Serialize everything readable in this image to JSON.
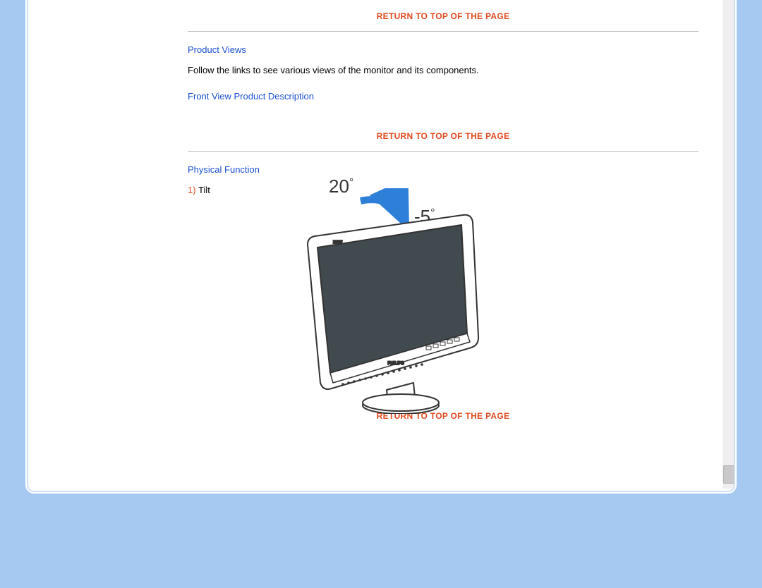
{
  "return_link_text": "RETURN TO TOP OF THE PAGE",
  "product_views": {
    "heading": "Product Views",
    "description": "Follow the links to see various views of the monitor and its components.",
    "front_view_link": "Front View Product Description"
  },
  "physical_function": {
    "heading": "Physical Function",
    "item_number": "1)",
    "item_label": "Tilt"
  },
  "diagram": {
    "angle_back": "20",
    "angle_forward": "-5",
    "brand_label": "PHILIPS",
    "model_label": "230W"
  },
  "colors": {
    "page_bg": "#a5c9f0",
    "heading_blue": "#1a4fd1",
    "accent_orange": "#e34a1f",
    "rule_gray": "#bfbfbf"
  }
}
